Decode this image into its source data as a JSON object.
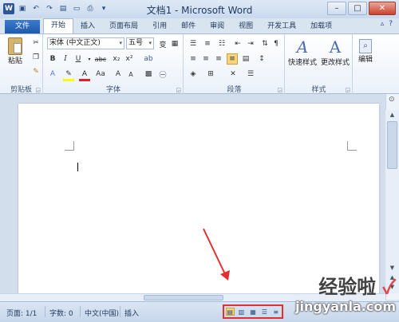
{
  "window": {
    "title": "文档1 - Microsoft Word",
    "qat_icons": [
      "word-logo",
      "save-icon",
      "undo-icon",
      "redo-icon",
      "open-icon",
      "new-icon",
      "print-preview-icon",
      "customize-icon"
    ],
    "controls": {
      "minimize": "–",
      "maximize": "□",
      "close": "✕"
    }
  },
  "tabs": [
    {
      "label": "文件",
      "kind": "file"
    },
    {
      "label": "开始",
      "kind": "active"
    },
    {
      "label": "插入"
    },
    {
      "label": "页面布局"
    },
    {
      "label": "引用"
    },
    {
      "label": "邮件"
    },
    {
      "label": "审阅"
    },
    {
      "label": "视图"
    },
    {
      "label": "开发工具"
    },
    {
      "label": "加载项"
    }
  ],
  "ribbon": {
    "clipboard": {
      "paste": "粘贴",
      "label": "剪贴板"
    },
    "font": {
      "font_name": "宋体 (中文正文)",
      "font_size": "五号",
      "label": "字体",
      "bold": "B",
      "italic": "I",
      "underline": "U",
      "strike": "abc",
      "sub": "x₂",
      "sup": "x²",
      "grow": "A",
      "shrink": "A",
      "aa": "Aa",
      "font_color": "A"
    },
    "paragraph": {
      "label": "段落"
    },
    "styles": {
      "quick": "快速样式",
      "change": "更改样式",
      "label": "样式"
    },
    "editing": {
      "label": "编辑"
    }
  },
  "status": {
    "page": "页面: 1/1",
    "words": "字数: 0",
    "lang": "中文(中国)",
    "mode": "插入"
  },
  "watermark": {
    "line1": "经验啦",
    "check": "✓",
    "line2": "jingyanla.com"
  },
  "colors": {
    "accent": "#2b5797",
    "highlight": "#e03030"
  }
}
